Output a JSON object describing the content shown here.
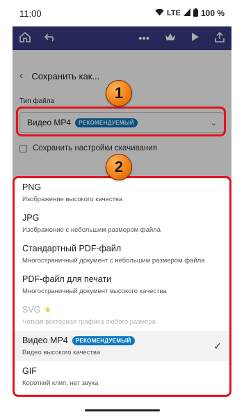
{
  "status_bar": {
    "time": "11:00",
    "network": "LTE",
    "battery": "100 %"
  },
  "toolbar": {
    "icons": [
      "home-icon",
      "undo-icon",
      "more-icon",
      "crown-icon",
      "play-icon",
      "share-icon"
    ]
  },
  "save_sheet": {
    "title": "Сохранить как...",
    "file_type_label": "Тип файла",
    "selected_value": "Видео MP4",
    "selected_badge": "РЕКОМЕНДУЕМЫЙ",
    "save_settings_label": "Сохранить настройки скачивания"
  },
  "options": [
    {
      "title": "PNG",
      "desc": "Изображение высокого качества"
    },
    {
      "title": "JPG",
      "desc": "Изображение с небольшим размером файла"
    },
    {
      "title": "Стандартный PDF-файл",
      "desc": "Многостраничный документ с небольшим размером файла"
    },
    {
      "title": "PDF-файл для печати",
      "desc": "Многостраничный документ высокого качества"
    },
    {
      "title": "SVG",
      "desc": "Четкая векторная графика любого размера"
    },
    {
      "title": "Видео MP4",
      "badge": "РЕКОМЕНДУЕМЫЙ",
      "desc": "Видео высокого качества"
    },
    {
      "title": "GIF",
      "desc": "Короткий клип, нет звука"
    }
  ],
  "annotations": {
    "one": "1",
    "two": "2"
  },
  "colors": {
    "accent": "#0a78c2",
    "annotation": "#e0141f",
    "toolbar": "#3b3d86"
  }
}
